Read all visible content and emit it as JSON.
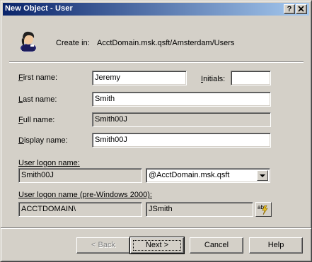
{
  "window": {
    "title": "New Object - User",
    "help_button": "?",
    "close_button": "X"
  },
  "header": {
    "create_in_label": "Create in:",
    "create_in_path": "AcctDomain.msk.qsft/Amsterdam/Users",
    "icon": "user-icon"
  },
  "form": {
    "first_name_label": "First name:",
    "first_name_value": "Jeremy",
    "initials_label": "Initials:",
    "initials_value": "",
    "last_name_label": "Last name:",
    "last_name_value": "Smith",
    "full_name_label": "Full name:",
    "full_name_value": "Smith00J",
    "display_name_label": "Display name:",
    "display_name_value": "Smith00J",
    "logon_name_label": "User logon name:",
    "logon_name_value": "Smith00J",
    "upn_suffix_value": "@AcctDomain.msk.qsft",
    "pre2000_label": "User logon name (pre-Windows 2000):",
    "pre2000_domain_value": "ACCTDOMAIN\\",
    "pre2000_name_value": "JSmith",
    "generate_icon": "generate-name-icon"
  },
  "buttons": {
    "back": "< Back",
    "next": "Next >",
    "cancel": "Cancel",
    "help": "Help"
  }
}
